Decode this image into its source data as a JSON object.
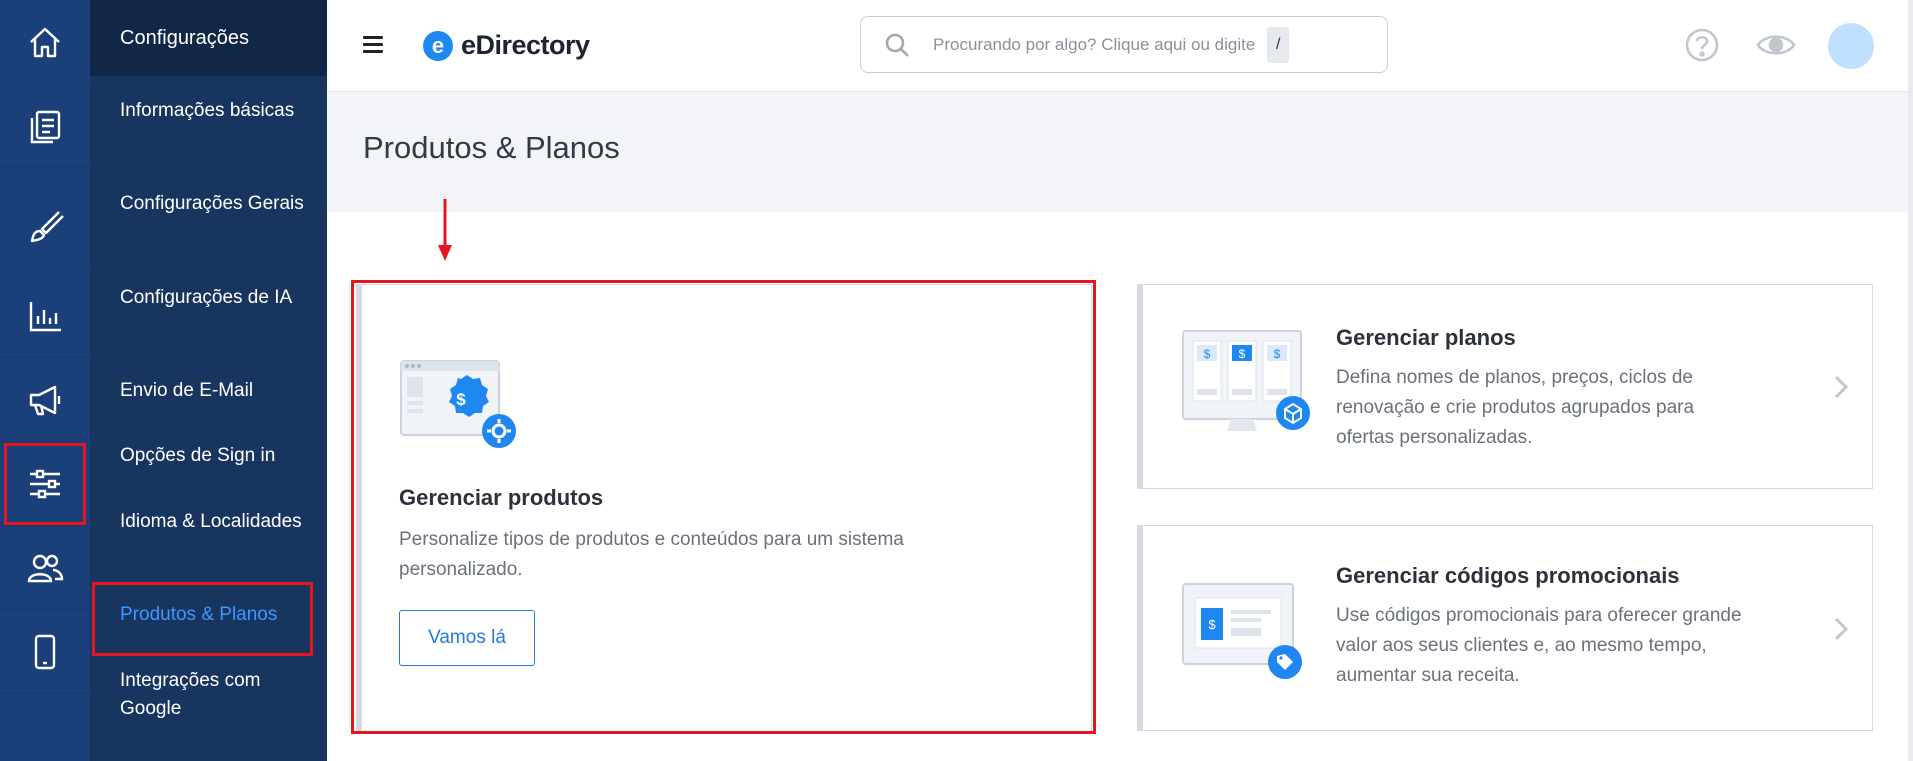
{
  "rail": {
    "items": [
      {
        "icon": "home-icon"
      },
      {
        "icon": "content-icon"
      },
      {
        "icon": "brush-icon"
      },
      {
        "icon": "reports-icon"
      },
      {
        "icon": "promote-icon"
      },
      {
        "icon": "settings-sliders-icon",
        "active": true
      },
      {
        "icon": "users-icon"
      },
      {
        "icon": "mobile-icon"
      }
    ]
  },
  "sidebar": {
    "header": "Configurações",
    "items": [
      {
        "label": "Informações básicas"
      },
      {
        "label": "Configurações Gerais"
      },
      {
        "label": "Configurações de IA"
      },
      {
        "label": "Envio de E-Mail"
      },
      {
        "label": "Opções de Sign in"
      },
      {
        "label": "Idioma & Localidades"
      },
      {
        "label": "Produtos & Planos",
        "active": true
      },
      {
        "label": "Integrações com Google"
      }
    ]
  },
  "topbar": {
    "logo_mark": "e",
    "logo_text": "eDirectory",
    "search_placeholder": "Procurando por algo? Clique aqui ou digite",
    "search_shortcut": "/",
    "icons": [
      "help-icon",
      "eye-icon"
    ]
  },
  "page": {
    "title": "Produtos & Planos"
  },
  "cards": {
    "products": {
      "title": "Gerenciar produtos",
      "description": "Personalize tipos de produtos e conteúdos para um sistema personalizado.",
      "button": "Vamos lá"
    },
    "plans": {
      "title": "Gerenciar planos",
      "description": "Defina nomes de planos, preços, ciclos de renovação e crie produtos agrupados para ofertas personalizadas."
    },
    "promo": {
      "title": "Gerenciar códigos promocionais",
      "description": "Use códigos promocionais para oferecer grande valor aos seus clientes e, ao mesmo tempo, aumentar sua receita."
    }
  },
  "colors": {
    "rail_bg": "#1a3f79",
    "sidebar_bg": "#18355f",
    "accent": "#1e88f0",
    "highlight": "#e8141e"
  }
}
